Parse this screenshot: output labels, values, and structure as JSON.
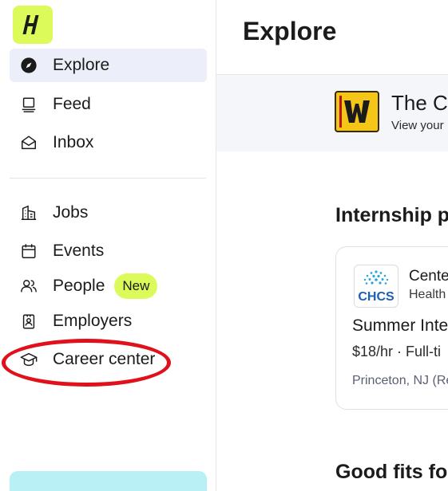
{
  "sidebar": {
    "logo_glyph": "H",
    "primary_items": [
      {
        "label": "Explore",
        "icon": "compass-icon",
        "active": true
      },
      {
        "label": "Feed",
        "icon": "feed-icon",
        "active": false
      },
      {
        "label": "Inbox",
        "icon": "inbox-icon",
        "active": false
      }
    ],
    "secondary_items": [
      {
        "label": "Jobs",
        "icon": "building-icon"
      },
      {
        "label": "Events",
        "icon": "calendar-icon"
      },
      {
        "label": "People",
        "icon": "people-icon",
        "badge": "New"
      },
      {
        "label": "Employers",
        "icon": "id-badge-icon"
      },
      {
        "label": "Career center",
        "icon": "graduation-cap-icon",
        "highlighted": true
      }
    ]
  },
  "main": {
    "title": "Explore",
    "banner": {
      "title": "The C",
      "subtitle": "View your"
    },
    "internship_section": {
      "title": "Internship p",
      "card": {
        "company_logo_text": "CHCS",
        "company_name": "Cente",
        "company_industry": "Health",
        "job_title": "Summer Inte",
        "pay": "$18/hr · Full-ti",
        "location": "Princeton, NJ (Re"
      }
    },
    "good_fits_section": {
      "title": "Good fits fo"
    }
  },
  "colors": {
    "brand_lime": "#dcfb5a",
    "active_nav_bg": "#eceef9",
    "annotation_red": "#e0111b",
    "banner_bg": "#f5f6fa",
    "handbook_yellow": "#f5c518"
  }
}
